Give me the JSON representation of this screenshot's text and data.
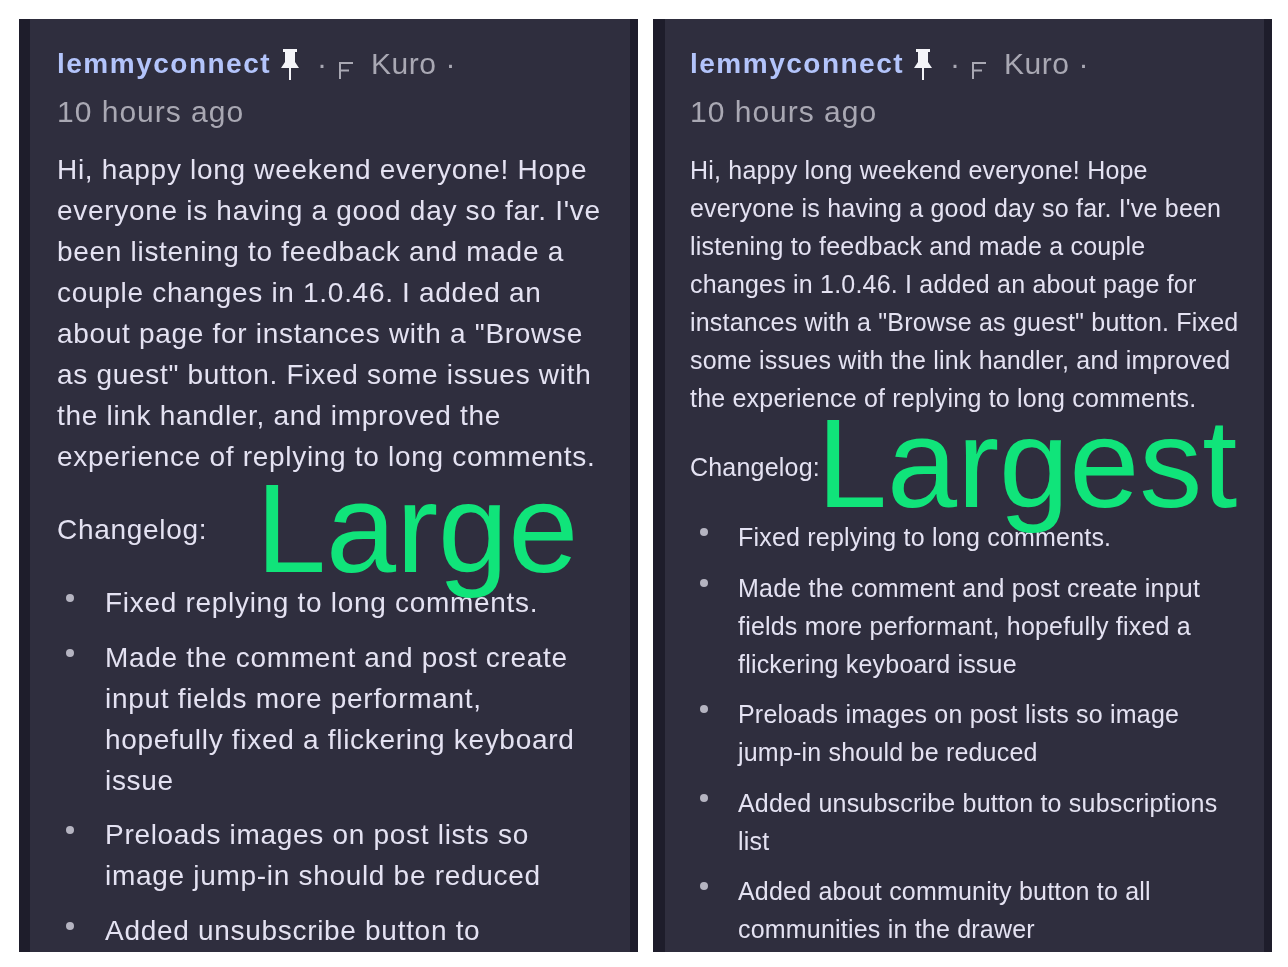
{
  "panels": [
    {
      "kind": "large",
      "annotation": "Large",
      "post": {
        "community": "lemmyconnect",
        "pinned": true,
        "separator_before_user": "·",
        "user": "Kuro",
        "separator_after_user": "·",
        "time": "10 hours ago",
        "body": "Hi, happy long weekend everyone! Hope everyone is having a good day so far. I've been listening to feedback and made a couple changes in 1.0.46. I added an about page for instances with a \"Browse as guest\" button. Fixed some issues with the link handler, and improved the experience of replying to long comments.",
        "changelog_heading": "Changelog:",
        "changelog": [
          "Fixed replying to long comments.",
          "Made the comment and post create input fields more performant, hopefully fixed a flickering keyboard issue",
          "Preloads images on post lists so image jump-in should be reduced",
          "Added unsubscribe button to"
        ]
      }
    },
    {
      "kind": "largest",
      "annotation": "Largest",
      "post": {
        "community": "lemmyconnect",
        "pinned": true,
        "separator_before_user": "·",
        "user": "Kuro",
        "separator_after_user": "·",
        "time": "10 hours ago",
        "body": "Hi, happy long weekend everyone! Hope everyone is having a good day so far. I've been listening to feedback and made a couple changes in 1.0.46. I added an about page for instances with a \"Browse as guest\" button. Fixed some issues with the link handler, and improved the experience of replying to long comments.",
        "changelog_heading": "Changelog:",
        "changelog": [
          "Fixed replying to long comments.",
          "Made the comment and post create input fields more performant, hopefully fixed a flickering keyboard issue",
          "Preloads images on post lists so image jump-in should be reduced",
          "Added unsubscribe button to subscriptions list",
          "Added about community button to all communities in the drawer"
        ]
      }
    }
  ]
}
